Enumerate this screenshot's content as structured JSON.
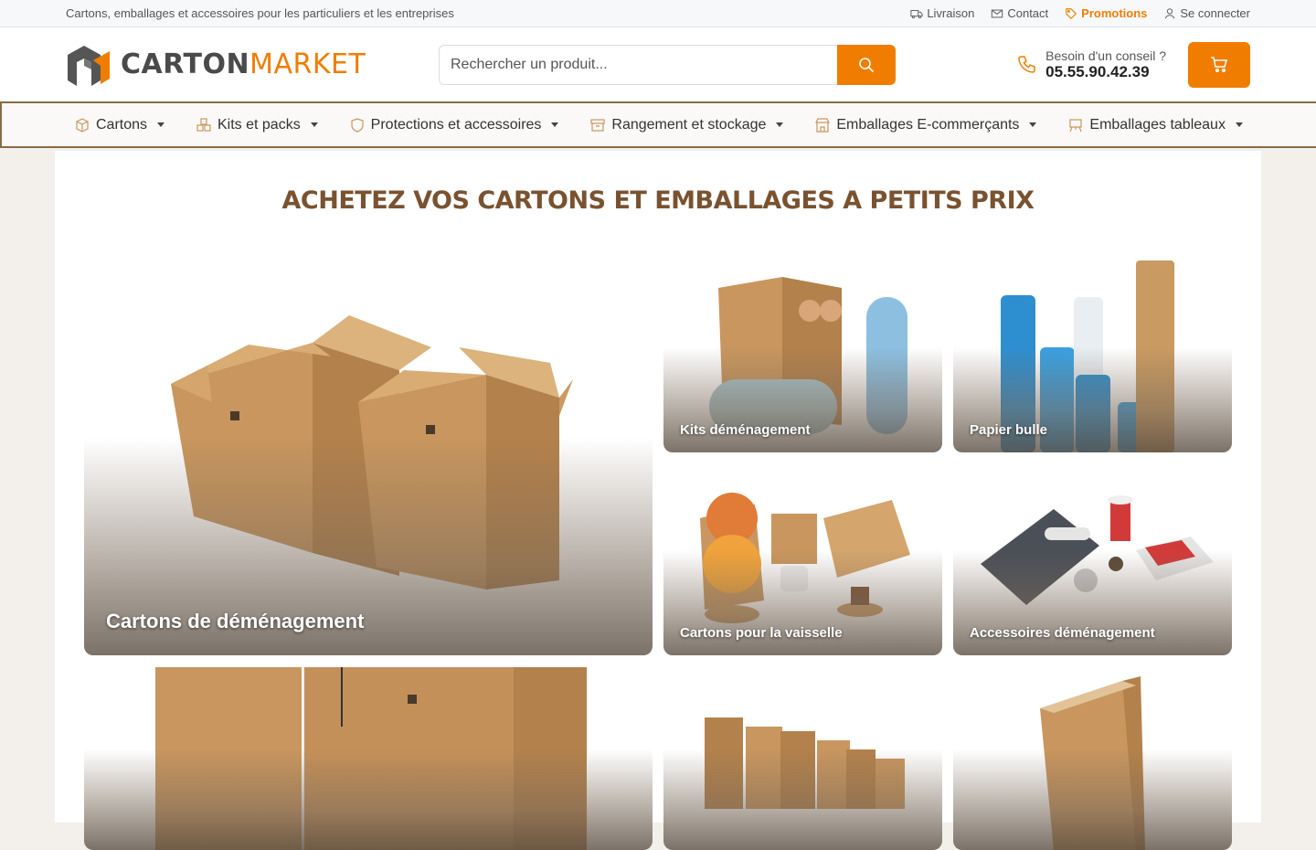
{
  "topbar": {
    "tagline": "Cartons, emballages et accessoires pour les particuliers et les entreprises",
    "links": [
      {
        "label": "Livraison",
        "icon": "truck-icon"
      },
      {
        "label": "Contact",
        "icon": "mail-icon"
      },
      {
        "label": "Promotions",
        "icon": "tag-icon"
      },
      {
        "label": "Se connecter",
        "icon": "user-icon"
      }
    ]
  },
  "header": {
    "logo_part1": "CARTON",
    "logo_part2": "MARKET",
    "search_placeholder": "Rechercher un produit...",
    "advice_label": "Besoin d'un conseil ?",
    "phone": "05.55.90.42.39"
  },
  "nav": [
    {
      "label": "Cartons",
      "icon": "box-icon"
    },
    {
      "label": "Kits et packs",
      "icon": "boxes-icon"
    },
    {
      "label": "Protections et accessoires",
      "icon": "shield-icon"
    },
    {
      "label": "Rangement et stockage",
      "icon": "archive-icon"
    },
    {
      "label": "Emballages E-commerçants",
      "icon": "shop-icon"
    },
    {
      "label": "Emballages tableaux",
      "icon": "easel-icon"
    }
  ],
  "main": {
    "heading": "ACHETEZ VOS CARTONS ET EMBALLAGES A PETITS PRIX",
    "tiles": [
      {
        "label": "Cartons de déménagement"
      },
      {
        "label": "Kits déménagement"
      },
      {
        "label": "Papier bulle"
      },
      {
        "label": "Cartons pour la vaisselle"
      },
      {
        "label": "Accessoires déménagement"
      },
      {
        "label": ""
      },
      {
        "label": ""
      },
      {
        "label": ""
      }
    ]
  },
  "colors": {
    "accent": "#f07d00",
    "brown": "#7a5230",
    "kraft": "#c8965e"
  }
}
